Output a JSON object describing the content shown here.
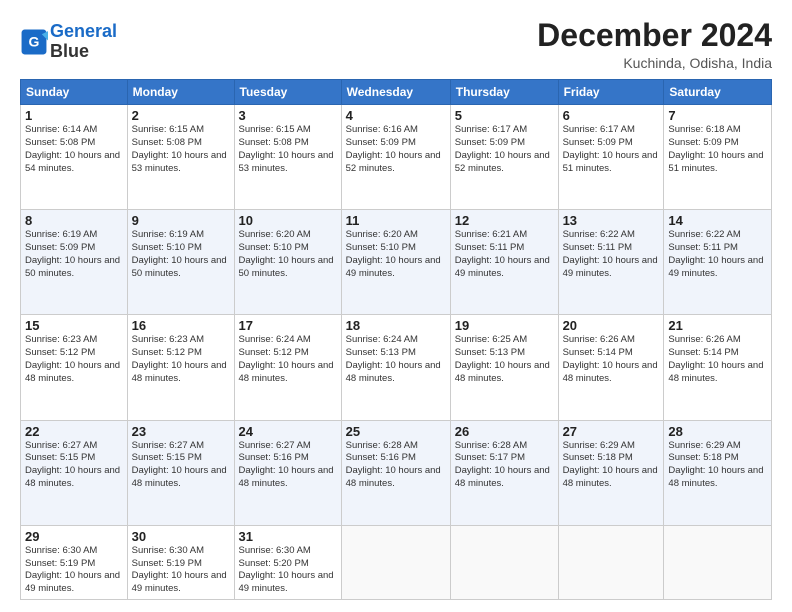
{
  "header": {
    "logo_line1": "General",
    "logo_line2": "Blue",
    "month": "December 2024",
    "location": "Kuchinda, Odisha, India"
  },
  "weekdays": [
    "Sunday",
    "Monday",
    "Tuesday",
    "Wednesday",
    "Thursday",
    "Friday",
    "Saturday"
  ],
  "weeks": [
    [
      {
        "day": "1",
        "rise": "6:14 AM",
        "set": "5:08 PM",
        "hours": "10 hours and 54 minutes"
      },
      {
        "day": "2",
        "rise": "6:15 AM",
        "set": "5:08 PM",
        "hours": "10 hours and 53 minutes"
      },
      {
        "day": "3",
        "rise": "6:15 AM",
        "set": "5:08 PM",
        "hours": "10 hours and 53 minutes"
      },
      {
        "day": "4",
        "rise": "6:16 AM",
        "set": "5:09 PM",
        "hours": "10 hours and 52 minutes"
      },
      {
        "day": "5",
        "rise": "6:17 AM",
        "set": "5:09 PM",
        "hours": "10 hours and 52 minutes"
      },
      {
        "day": "6",
        "rise": "6:17 AM",
        "set": "5:09 PM",
        "hours": "10 hours and 51 minutes"
      },
      {
        "day": "7",
        "rise": "6:18 AM",
        "set": "5:09 PM",
        "hours": "10 hours and 51 minutes"
      }
    ],
    [
      {
        "day": "8",
        "rise": "6:19 AM",
        "set": "5:09 PM",
        "hours": "10 hours and 50 minutes"
      },
      {
        "day": "9",
        "rise": "6:19 AM",
        "set": "5:10 PM",
        "hours": "10 hours and 50 minutes"
      },
      {
        "day": "10",
        "rise": "6:20 AM",
        "set": "5:10 PM",
        "hours": "10 hours and 50 minutes"
      },
      {
        "day": "11",
        "rise": "6:20 AM",
        "set": "5:10 PM",
        "hours": "10 hours and 49 minutes"
      },
      {
        "day": "12",
        "rise": "6:21 AM",
        "set": "5:11 PM",
        "hours": "10 hours and 49 minutes"
      },
      {
        "day": "13",
        "rise": "6:22 AM",
        "set": "5:11 PM",
        "hours": "10 hours and 49 minutes"
      },
      {
        "day": "14",
        "rise": "6:22 AM",
        "set": "5:11 PM",
        "hours": "10 hours and 49 minutes"
      }
    ],
    [
      {
        "day": "15",
        "rise": "6:23 AM",
        "set": "5:12 PM",
        "hours": "10 hours and 48 minutes"
      },
      {
        "day": "16",
        "rise": "6:23 AM",
        "set": "5:12 PM",
        "hours": "10 hours and 48 minutes"
      },
      {
        "day": "17",
        "rise": "6:24 AM",
        "set": "5:12 PM",
        "hours": "10 hours and 48 minutes"
      },
      {
        "day": "18",
        "rise": "6:24 AM",
        "set": "5:13 PM",
        "hours": "10 hours and 48 minutes"
      },
      {
        "day": "19",
        "rise": "6:25 AM",
        "set": "5:13 PM",
        "hours": "10 hours and 48 minutes"
      },
      {
        "day": "20",
        "rise": "6:26 AM",
        "set": "5:14 PM",
        "hours": "10 hours and 48 minutes"
      },
      {
        "day": "21",
        "rise": "6:26 AM",
        "set": "5:14 PM",
        "hours": "10 hours and 48 minutes"
      }
    ],
    [
      {
        "day": "22",
        "rise": "6:27 AM",
        "set": "5:15 PM",
        "hours": "10 hours and 48 minutes"
      },
      {
        "day": "23",
        "rise": "6:27 AM",
        "set": "5:15 PM",
        "hours": "10 hours and 48 minutes"
      },
      {
        "day": "24",
        "rise": "6:27 AM",
        "set": "5:16 PM",
        "hours": "10 hours and 48 minutes"
      },
      {
        "day": "25",
        "rise": "6:28 AM",
        "set": "5:16 PM",
        "hours": "10 hours and 48 minutes"
      },
      {
        "day": "26",
        "rise": "6:28 AM",
        "set": "5:17 PM",
        "hours": "10 hours and 48 minutes"
      },
      {
        "day": "27",
        "rise": "6:29 AM",
        "set": "5:18 PM",
        "hours": "10 hours and 48 minutes"
      },
      {
        "day": "28",
        "rise": "6:29 AM",
        "set": "5:18 PM",
        "hours": "10 hours and 48 minutes"
      }
    ],
    [
      {
        "day": "29",
        "rise": "6:30 AM",
        "set": "5:19 PM",
        "hours": "10 hours and 49 minutes"
      },
      {
        "day": "30",
        "rise": "6:30 AM",
        "set": "5:19 PM",
        "hours": "10 hours and 49 minutes"
      },
      {
        "day": "31",
        "rise": "6:30 AM",
        "set": "5:20 PM",
        "hours": "10 hours and 49 minutes"
      },
      null,
      null,
      null,
      null
    ]
  ]
}
